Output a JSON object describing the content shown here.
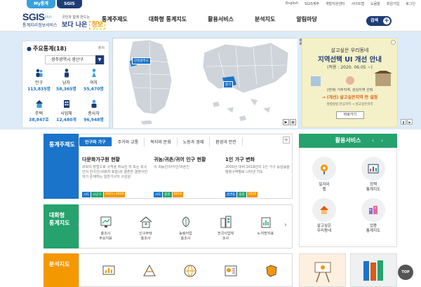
{
  "site_tabs": [
    "My통계",
    "SGIS"
  ],
  "util_links": [
    "English",
    "SGIS계주",
    "개발지원센터",
    "사이트맵",
    "도움말",
    "회원가입",
    "로그인"
  ],
  "logo": {
    "main": "SGIS",
    "plus": "plus",
    "sub": "통계지리정보서비스"
  },
  "slogan": {
    "top": "국민과 함께 만드는",
    "main_prefix": "보다 나은",
    "main_highlight": "정보"
  },
  "gnb": [
    "통계주제도",
    "대화형 통계지도",
    "활용서비스",
    "분석지도",
    "알림마당"
  ],
  "search_label": "검색",
  "stats": {
    "title": "주요통계(18)",
    "share": "출처",
    "region": "광주광역시 광산구",
    "items": [
      {
        "label": "인구",
        "value": "113,835명",
        "icon": "population-icon"
      },
      {
        "label": "남자",
        "value": "58,365명",
        "icon": "male-icon"
      },
      {
        "label": "여자",
        "value": "55,470명",
        "icon": "female-icon"
      },
      {
        "label": "주택",
        "value": "38,847호",
        "icon": "house-icon"
      },
      {
        "label": "사업체",
        "value": "12,480개",
        "icon": "building-icon"
      },
      {
        "label": "종사자",
        "value": "96,948명",
        "icon": "worker-icon"
      }
    ]
  },
  "map": {
    "label1": "인천광역시",
    "label2": "중구"
  },
  "banner": {
    "line1": "살고싶은 우리동네",
    "line2": "지역선택 UI 개선 안내",
    "line3": "(적용 : 2020. 06.05 ~)",
    "line4": "(현재) 거주지역, 관심지역 선택",
    "line5": "→ (개선) 살고싶은지역 만 설정",
    "line6": "정렬방법 관심지역 → 살고싶은지역",
    "button": "바로가기"
  },
  "thematic": {
    "label": "통계주제도",
    "tabs": [
      "인구와 가구",
      "주거와 교통",
      "복지와 문화",
      "노동과 경제",
      "환경과 안전"
    ],
    "cards": [
      {
        "title": "다문화가구원 현황",
        "desc": "귀화의 방법으로 국적을 취득한 자 또는 외국인이 한국인(귀화자 포함)과 결혼한 결혼이민자가 존재하는 일반가구의 구성원",
        "tags": [
          "시도",
          "시군구",
          "2015~2019"
        ]
      },
      {
        "title": "귀농/귀촌/귀어 인구 현황",
        "desc": "이 귀농인/이어인/귀촌인",
        "tags": [
          "시도",
          "중감",
          "2019"
        ]
      },
      {
        "title": "1인 가구 변화",
        "desc": "2000년 대비 2018년의 1인 가구 증감률을 행정구역별로 나타낸 지도",
        "tags": [
          "읍면동",
          "중감",
          "2018"
        ]
      }
    ]
  },
  "usage": {
    "label": "활용서비스",
    "items": [
      {
        "label": "일자리\n맵",
        "icon": "job-map-icon"
      },
      {
        "label": "정책\n통계지도",
        "icon": "policy-map-icon"
      },
      {
        "label": "살고싶은\n우리동네",
        "icon": "neighborhood-icon"
      },
      {
        "label": "업종\n통계지도",
        "icon": "industry-map-icon"
      }
    ]
  },
  "interactive": {
    "label": "대화형\n통계지도",
    "items": [
      {
        "label": "총조사\n주요지표",
        "icon": "census-icon"
      },
      {
        "label": "인구주택\n총조사",
        "icon": "housing-census-icon"
      },
      {
        "label": "농림어업\n총조사",
        "icon": "agriculture-census-icon"
      },
      {
        "label": "전국사업체\n조사",
        "icon": "business-survey-icon"
      },
      {
        "label": "e-지방지표",
        "icon": "local-indicator-icon"
      }
    ]
  },
  "analysis": {
    "label": "분석지도"
  },
  "top_button": "TOP",
  "colors": {
    "navy": "#1e3d76",
    "blue": "#1a74c9",
    "green": "#25a26d",
    "orange": "#f39800",
    "hero": "#dcebf7"
  }
}
